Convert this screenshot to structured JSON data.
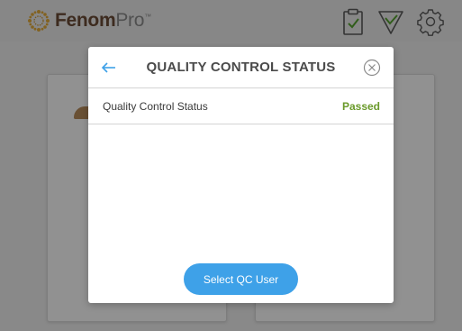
{
  "app": {
    "logo_bold": "Fenom",
    "logo_light": "Pro",
    "logo_mark": "™",
    "header_icons": [
      "clipboard-check-icon",
      "triangle-check-icon",
      "gear-icon"
    ],
    "brand_color": "#6a4a36"
  },
  "modal": {
    "title": "QUALITY CONTROL STATUS",
    "back_icon": "arrow-left-icon",
    "close_icon": "close-circle-icon",
    "status_row": {
      "label": "Quality Control Status",
      "value": "Passed",
      "value_color": "#6a9a2a"
    },
    "primary_button": {
      "label": "Select QC User",
      "color": "#3ea1e8"
    }
  }
}
